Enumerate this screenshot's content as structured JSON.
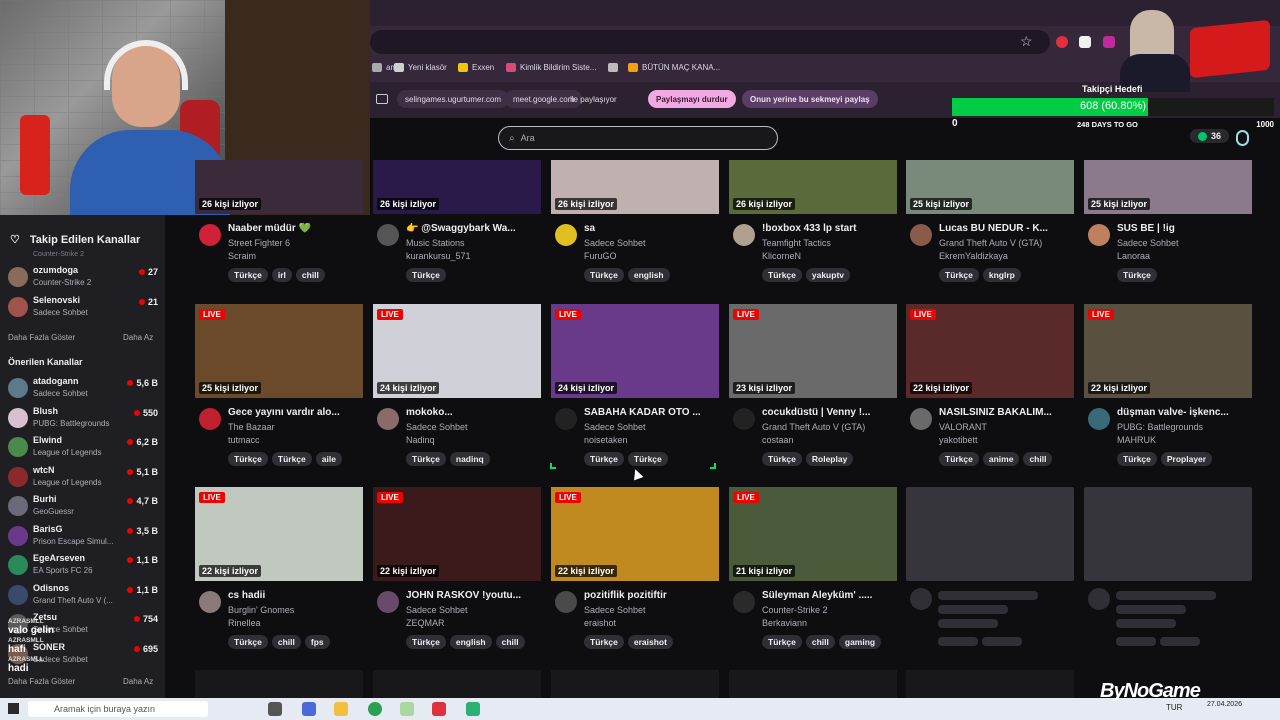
{
  "browser": {
    "bookmarks": [
      {
        "label": "am",
        "color": "#aaaaaa"
      },
      {
        "label": "Yeni klasör",
        "color": "#cfcfcf"
      },
      {
        "label": "Exxen",
        "color": "#f2c40f"
      },
      {
        "label": "Kimlik Bildirim Siste...",
        "color": "#d84a7a"
      },
      {
        "label": "",
        "color": "#bbbbbb"
      },
      {
        "label": "BÜTÜN MAÇ KANA...",
        "color": "#f2a00f"
      }
    ],
    "share": {
      "url1": "selingames.ugurtumer.com",
      "url2": "meet.google.com",
      "text": "ile paylaşıyor",
      "stop_label": "Paylaşmayı durdur",
      "instead_label": "Onun yerine bu sekmeyi paylaş"
    }
  },
  "search": {
    "placeholder": "Ara"
  },
  "follower_goal": {
    "title": "Takipçi Hedefi",
    "value_text": "608 (60.80%)",
    "progress": 0.608,
    "min": "0",
    "max": "1000",
    "days_left": "248 DAYS TO GO"
  },
  "top_right_badge": {
    "count": "36"
  },
  "sidebar": {
    "followed_title": "Takip Edilen Kanallar",
    "followed_partial_cat": "Counter-Strike 2",
    "followed": [
      {
        "name": "ozumdoga",
        "category": "Counter-Strike 2",
        "viewers": "27",
        "color": "#8a6a5a"
      },
      {
        "name": "Selenovski",
        "category": "Sadece Sohbet",
        "viewers": "21",
        "color": "#a0524d"
      }
    ],
    "show_more": "Daha Fazla Göster",
    "show_less": "Daha Az",
    "recommended_title": "Önerilen Kanallar",
    "recommended": [
      {
        "name": "atadogann",
        "category": "Sadece Sohbet",
        "viewers": "5,6 B",
        "color": "#5d7a8a"
      },
      {
        "name": "Blush",
        "category": "PUBG: Battlegrounds",
        "viewers": "550",
        "color": "#d8c0d0"
      },
      {
        "name": "Elwind",
        "category": "League of Legends",
        "viewers": "6,2 B",
        "color": "#4a8a4a"
      },
      {
        "name": "wtcN",
        "category": "League of Legends",
        "viewers": "5,1 B",
        "color": "#8a2a2a"
      },
      {
        "name": "Burhi",
        "category": "GeoGuessr",
        "viewers": "4,7 B",
        "color": "#6a6a7a"
      },
      {
        "name": "BarisG",
        "category": "Prison Escape Simul...",
        "viewers": "3,5 B",
        "color": "#6a3a8a"
      },
      {
        "name": "EgeArseven",
        "category": "EA Sports FC 26",
        "viewers": "1,1 B",
        "color": "#2a8a5a"
      },
      {
        "name": "Odisnos",
        "category": "Grand Theft Auto V (...",
        "viewers": "1,1 B",
        "color": "#3a4a6a"
      },
      {
        "name": "Zetsu",
        "category": "Sadece Sohbet",
        "viewers": "754",
        "color": "#5a5a5a"
      },
      {
        "name": "SONER",
        "category": "Sadece Sohbet",
        "viewers": "695",
        "color": "#7a5a4a"
      }
    ]
  },
  "cards": [
    {
      "viewers": "26 kişi izliyor",
      "live": "",
      "title": "Naaber müdür 💚",
      "category": "Street Fighter 6",
      "user": "Scraim",
      "tags": [
        "Türkçe",
        "irl",
        "chill"
      ],
      "thumb": "#3a2a3a",
      "avatar": "#d0203a"
    },
    {
      "viewers": "26 kişi izliyor",
      "live": "",
      "title": "👉 @Swaggybark Wa...",
      "category": "Music Stations",
      "user": "kurankursu_571",
      "tags": [
        "Türkçe"
      ],
      "thumb": "#2a1a4a",
      "avatar": "#555555"
    },
    {
      "viewers": "26 kişi izliyor",
      "live": "",
      "title": "sa",
      "category": "Sadece Sohbet",
      "user": "FuruGO",
      "tags": [
        "Türkçe",
        "english"
      ],
      "thumb": "#c0b0b0",
      "avatar": "#e0c020"
    },
    {
      "viewers": "26 kişi izliyor",
      "live": "",
      "title": "!boxbox 433 lp start",
      "category": "Teamfight Tactics",
      "user": "KlicorneN",
      "tags": [
        "Türkçe",
        "yakuptv"
      ],
      "thumb": "#5a6a3a",
      "avatar": "#b0a090"
    },
    {
      "viewers": "25 kişi izliyor",
      "live": "",
      "title": "Lucas BU NEDUR - K...",
      "category": "Grand Theft Auto V (GTA)",
      "user": "EkremYaldizkaya",
      "tags": [
        "Türkçe",
        "knglrp"
      ],
      "thumb": "#7a8a7a",
      "avatar": "#8a5a4a"
    },
    {
      "viewers": "25 kişi izliyor",
      "live": "",
      "title": "SUS BE | !ig",
      "category": "Sadece Sohbet",
      "user": "Lanoraa",
      "tags": [
        "Türkçe"
      ],
      "thumb": "#8a7a8a",
      "avatar": "#c08060"
    },
    {
      "viewers": "25 kişi izliyor",
      "live": "LIVE",
      "title": "Gece yayını vardır alo...",
      "category": "The Bazaar",
      "user": "tutmacc",
      "tags": [
        "Türkçe",
        "Türkçe",
        "aile"
      ],
      "thumb": "#6a4a2a",
      "avatar": "#c02030"
    },
    {
      "viewers": "24 kişi izliyor",
      "live": "LIVE",
      "title": "mokoko...",
      "category": "Sadece Sohbet",
      "user": "Nadinq",
      "tags": [
        "Türkçe",
        "nadinq"
      ],
      "thumb": "#d0d0d8",
      "avatar": "#8a6a6a"
    },
    {
      "viewers": "24 kişi izliyor",
      "live": "LIVE",
      "title": "SABAHA KADAR OTO ...",
      "category": "Sadece Sohbet",
      "user": "noisetaken",
      "tags": [
        "Türkçe",
        "Türkçe"
      ],
      "thumb": "#6a3a8a",
      "avatar": "#222222"
    },
    {
      "viewers": "23 kişi izliyor",
      "live": "LIVE",
      "title": "cocukdüstü | Venny !...",
      "category": "Grand Theft Auto V (GTA)",
      "user": "costaan",
      "tags": [
        "Türkçe",
        "Roleplay"
      ],
      "thumb": "#6a6a6a",
      "avatar": "#222222"
    },
    {
      "viewers": "22 kişi izliyor",
      "live": "LIVE",
      "title": "NASILSINIZ BAKALIM...",
      "category": "VALORANT",
      "user": "yakotibett",
      "tags": [
        "Türkçe",
        "anime",
        "chill"
      ],
      "thumb": "#5a2a2a",
      "avatar": "#6a6a6a"
    },
    {
      "viewers": "22 kişi izliyor",
      "live": "LIVE",
      "title": "düşman valve- işkenc...",
      "category": "PUBG: Battlegrounds",
      "user": "MAHRUK",
      "tags": [
        "Türkçe",
        "Proplayer"
      ],
      "thumb": "#5a5040",
      "avatar": "#3a6a7a"
    },
    {
      "viewers": "22 kişi izliyor",
      "live": "LIVE",
      "title": "cs hadii",
      "category": "Burglin' Gnomes",
      "user": "Rinellea",
      "tags": [
        "Türkçe",
        "chill",
        "fps"
      ],
      "thumb": "#c0c8c0",
      "avatar": "#8a7a7a"
    },
    {
      "viewers": "22 kişi izliyor",
      "live": "LIVE",
      "title": "JOHN RASKOV !youtu...",
      "category": "Sadece Sohbet",
      "user": "ZEQMAR",
      "tags": [
        "Türkçe",
        "english",
        "chill"
      ],
      "thumb": "#3a1a1a",
      "avatar": "#6a4a6a"
    },
    {
      "viewers": "22 kişi izliyor",
      "live": "LIVE",
      "title": "pozitiflik pozitiftir",
      "category": "Sadece Sohbet",
      "user": "eraishot",
      "tags": [
        "Türkçe",
        "eraishot"
      ],
      "thumb": "#c08a20",
      "avatar": "#4a4a4a"
    },
    {
      "viewers": "21 kişi izliyor",
      "live": "LIVE",
      "title": "Süleyman Aleyküm' .....",
      "category": "Counter-Strike 2",
      "user": "Berkaviann",
      "tags": [
        "Türkçe",
        "chill",
        "gaming"
      ],
      "thumb": "#4a5a3a",
      "avatar": "#2a2a2a"
    }
  ],
  "chat": [
    {
      "user": "AZRASMLL",
      "msg": "valo gelin"
    },
    {
      "user": "AZRASMLL",
      "msg": "hafi"
    },
    {
      "user": "AZRASMLL",
      "msg": "hadi"
    }
  ],
  "taskbar": {
    "search_placeholder": "Aramak için buraya yazın",
    "lang": "TUR",
    "time": "",
    "date": "27.04.2026"
  },
  "brand": "ByNoGame"
}
